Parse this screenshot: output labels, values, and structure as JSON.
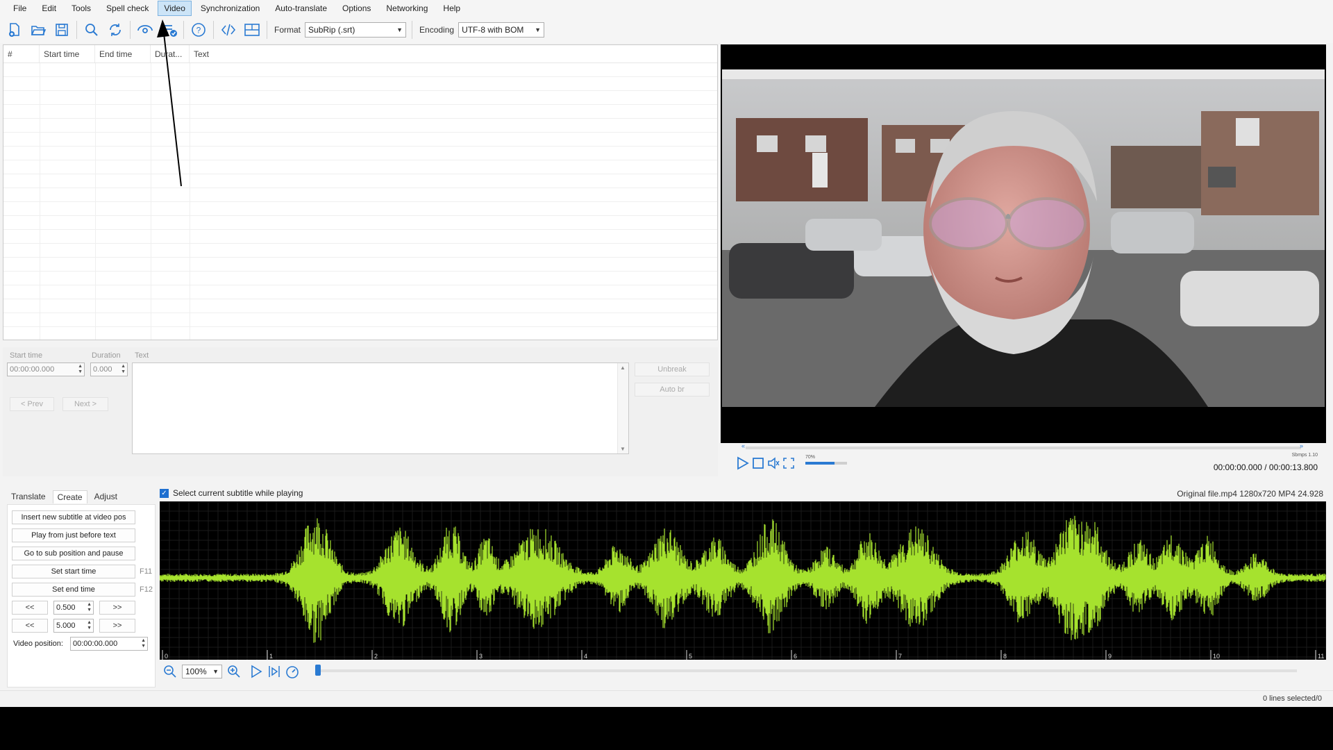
{
  "menu": [
    "File",
    "Edit",
    "Tools",
    "Spell check",
    "Video",
    "Synchronization",
    "Auto-translate",
    "Options",
    "Networking",
    "Help"
  ],
  "toolbar": {
    "icons": [
      "new-file-icon",
      "open-folder-icon",
      "save-icon",
      "find-icon",
      "replace-icon",
      "visual-sync-icon",
      "spell-check-icon",
      "help-icon",
      "source-view-icon",
      "list-view-icon"
    ],
    "format_label": "Format",
    "format_value": "SubRip (.srt)",
    "encoding_label": "Encoding",
    "encoding_value": "UTF-8 with BOM"
  },
  "grid": {
    "columns": [
      "#",
      "Start time",
      "End time",
      "Durat...",
      "Text"
    ]
  },
  "edit": {
    "start_time_label": "Start time",
    "start_time_value": "00:00:00.000",
    "duration_label": "Duration",
    "duration_value": "0.000",
    "text_label": "Text",
    "prev_label": "< Prev",
    "next_label": "Next >",
    "unbreak_label": "Unbreak",
    "auto_br_label": "Auto br"
  },
  "video": {
    "volume_pct": "70%",
    "small_label": "Sbmps 1.10",
    "time": "00:00:00.000 / 00:00:13.800",
    "volume_fraction": 0.7
  },
  "tabs": [
    "Translate",
    "Create",
    "Adjust"
  ],
  "active_tab": "Create",
  "create": {
    "insert_label": "Insert new subtitle at video pos",
    "play_before_label": "Play from just before text",
    "goto_label": "Go to sub position and pause",
    "set_start_label": "Set start time",
    "set_start_key": "F11",
    "set_end_label": "Set end time",
    "set_end_key": "F12",
    "back_label": "<<",
    "fwd_label": ">>",
    "step1": "0.500",
    "step2": "5.000",
    "video_pos_label": "Video position:",
    "video_pos_value": "00:00:00.000"
  },
  "waveform": {
    "select_current_label": "Select current subtitle while playing",
    "file_info": "Original file.mp4 1280x720 MP4 24.928",
    "zoom_value": "100%",
    "tick_labels": [
      "0",
      "1",
      "2",
      "3",
      "4",
      "5",
      "6",
      "7",
      "8",
      "9",
      "10",
      "11"
    ],
    "color": "#a6e22e"
  },
  "status": {
    "lines_selected": "0 lines selected/0"
  }
}
